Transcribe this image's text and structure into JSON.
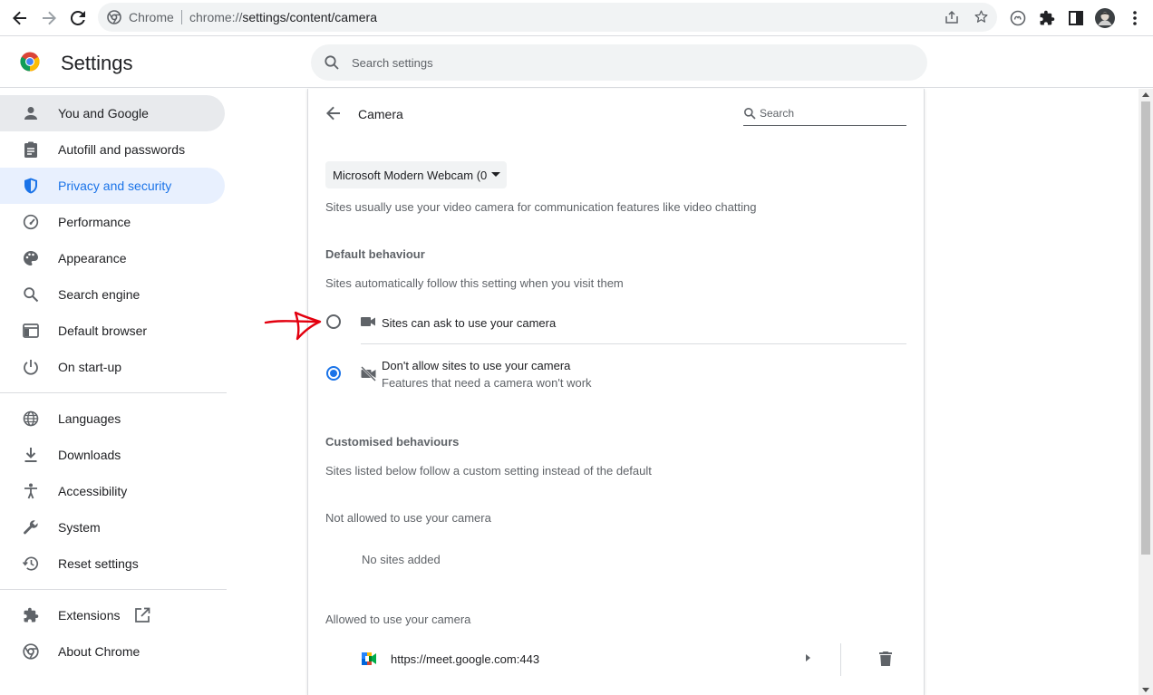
{
  "browser": {
    "app_name": "Chrome",
    "url_prefix": "chrome://",
    "url_path": "settings/content/camera"
  },
  "header": {
    "title": "Settings",
    "search_placeholder": "Search settings"
  },
  "sidebar": {
    "items": [
      {
        "label": "You and Google",
        "icon": "person-icon"
      },
      {
        "label": "Autofill and passwords",
        "icon": "clipboard-icon"
      },
      {
        "label": "Privacy and security",
        "icon": "shield-icon"
      },
      {
        "label": "Performance",
        "icon": "speedometer-icon"
      },
      {
        "label": "Appearance",
        "icon": "palette-icon"
      },
      {
        "label": "Search engine",
        "icon": "search-icon"
      },
      {
        "label": "Default browser",
        "icon": "browser-window-icon"
      },
      {
        "label": "On start-up",
        "icon": "power-icon"
      },
      {
        "label": "Languages",
        "icon": "globe-icon"
      },
      {
        "label": "Downloads",
        "icon": "download-icon"
      },
      {
        "label": "Accessibility",
        "icon": "accessibility-icon"
      },
      {
        "label": "System",
        "icon": "wrench-icon"
      },
      {
        "label": "Reset settings",
        "icon": "history-icon"
      },
      {
        "label": "Extensions",
        "icon": "puzzle-icon"
      },
      {
        "label": "About Chrome",
        "icon": "chrome-icon"
      }
    ]
  },
  "camera": {
    "title": "Camera",
    "search_placeholder": "Search",
    "device_selected": "Microsoft Modern Webcam (0",
    "description": "Sites usually use your video camera for communication features like video chatting",
    "default_behaviour_header": "Default behaviour",
    "default_behaviour_sub": "Sites automatically follow this setting when you visit them",
    "option_ask": "Sites can ask to use your camera",
    "option_block": "Don't allow sites to use your camera",
    "option_block_sub": "Features that need a camera won't work",
    "customised_header": "Customised behaviours",
    "customised_sub": "Sites listed below follow a custom setting instead of the default",
    "not_allowed_header": "Not allowed to use your camera",
    "no_sites": "No sites added",
    "allowed_header": "Allowed to use your camera",
    "allowed_site": "https://meet.google.com:443"
  },
  "colors": {
    "accent": "#1a73e8",
    "active_bg": "#e8f0fe",
    "annotation": "#e3000f"
  }
}
